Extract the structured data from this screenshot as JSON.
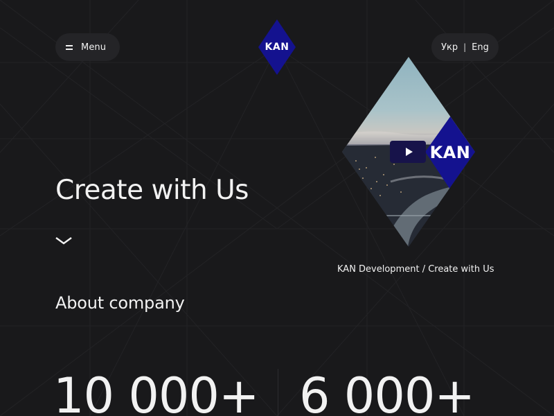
{
  "header": {
    "menu_label": "Menu",
    "logo_text": "KAN",
    "languages": [
      "Укр",
      "Eng"
    ],
    "lang_separator": "|"
  },
  "hero": {
    "title": "Create with Us"
  },
  "video": {
    "logo_text": "KAN",
    "caption": "KAN Development / Create with Us"
  },
  "about": {
    "title": "About company",
    "stats": [
      "10 000+",
      "6 000+"
    ]
  },
  "colors": {
    "background": "#19191b",
    "brand_blue": "#14128f",
    "pill_bg": "#242427",
    "text": "#f2f2f2"
  },
  "icons": {
    "menu": "hamburger-icon",
    "play": "play-icon",
    "scroll": "chevron-down-icon"
  }
}
